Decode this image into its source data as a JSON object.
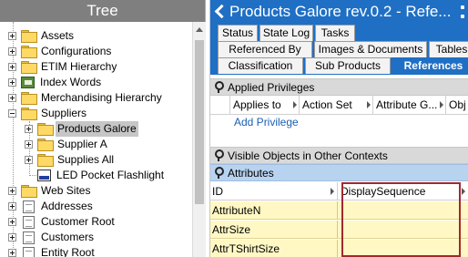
{
  "tree": {
    "title": "Tree",
    "items": [
      {
        "label": "Assets"
      },
      {
        "label": "Configurations"
      },
      {
        "label": "ETIM Hierarchy"
      },
      {
        "label": "Index Words"
      },
      {
        "label": "Merchandising Hierarchy"
      },
      {
        "label": "Suppliers"
      },
      {
        "label": "Products Galore"
      },
      {
        "label": "Supplier A"
      },
      {
        "label": "Supplies All"
      },
      {
        "label": "LED Pocket Flashlight"
      },
      {
        "label": "Web Sites"
      },
      {
        "label": "Addresses"
      },
      {
        "label": "Customer Root"
      },
      {
        "label": "Customers"
      },
      {
        "label": "Entity Root"
      }
    ]
  },
  "detail": {
    "title": "Products Galore rev.0.2 - Refe...",
    "tabs_row1": [
      "Status",
      "State Log",
      "Tasks"
    ],
    "tabs_row2": [
      "Referenced By",
      "Images & Documents",
      "Tables"
    ],
    "tabs_row3": [
      "Classification",
      "Sub Products",
      "References"
    ],
    "applied_privileges": {
      "title": "Applied Privileges",
      "columns": [
        "Applies to",
        "Action Set",
        "Attribute G...",
        "Obj"
      ],
      "add_link": "Add Privilege"
    },
    "visible_objects_title": "Visible Objects in Other Contexts",
    "attributes": {
      "title": "Attributes",
      "columns": [
        "ID",
        "DisplaySequence"
      ],
      "rows": [
        {
          "id": "AttributeN",
          "display_sequence": ""
        },
        {
          "id": "AttrSize",
          "display_sequence": ""
        },
        {
          "id": "AttrTShirtSize",
          "display_sequence": ""
        }
      ]
    }
  }
}
